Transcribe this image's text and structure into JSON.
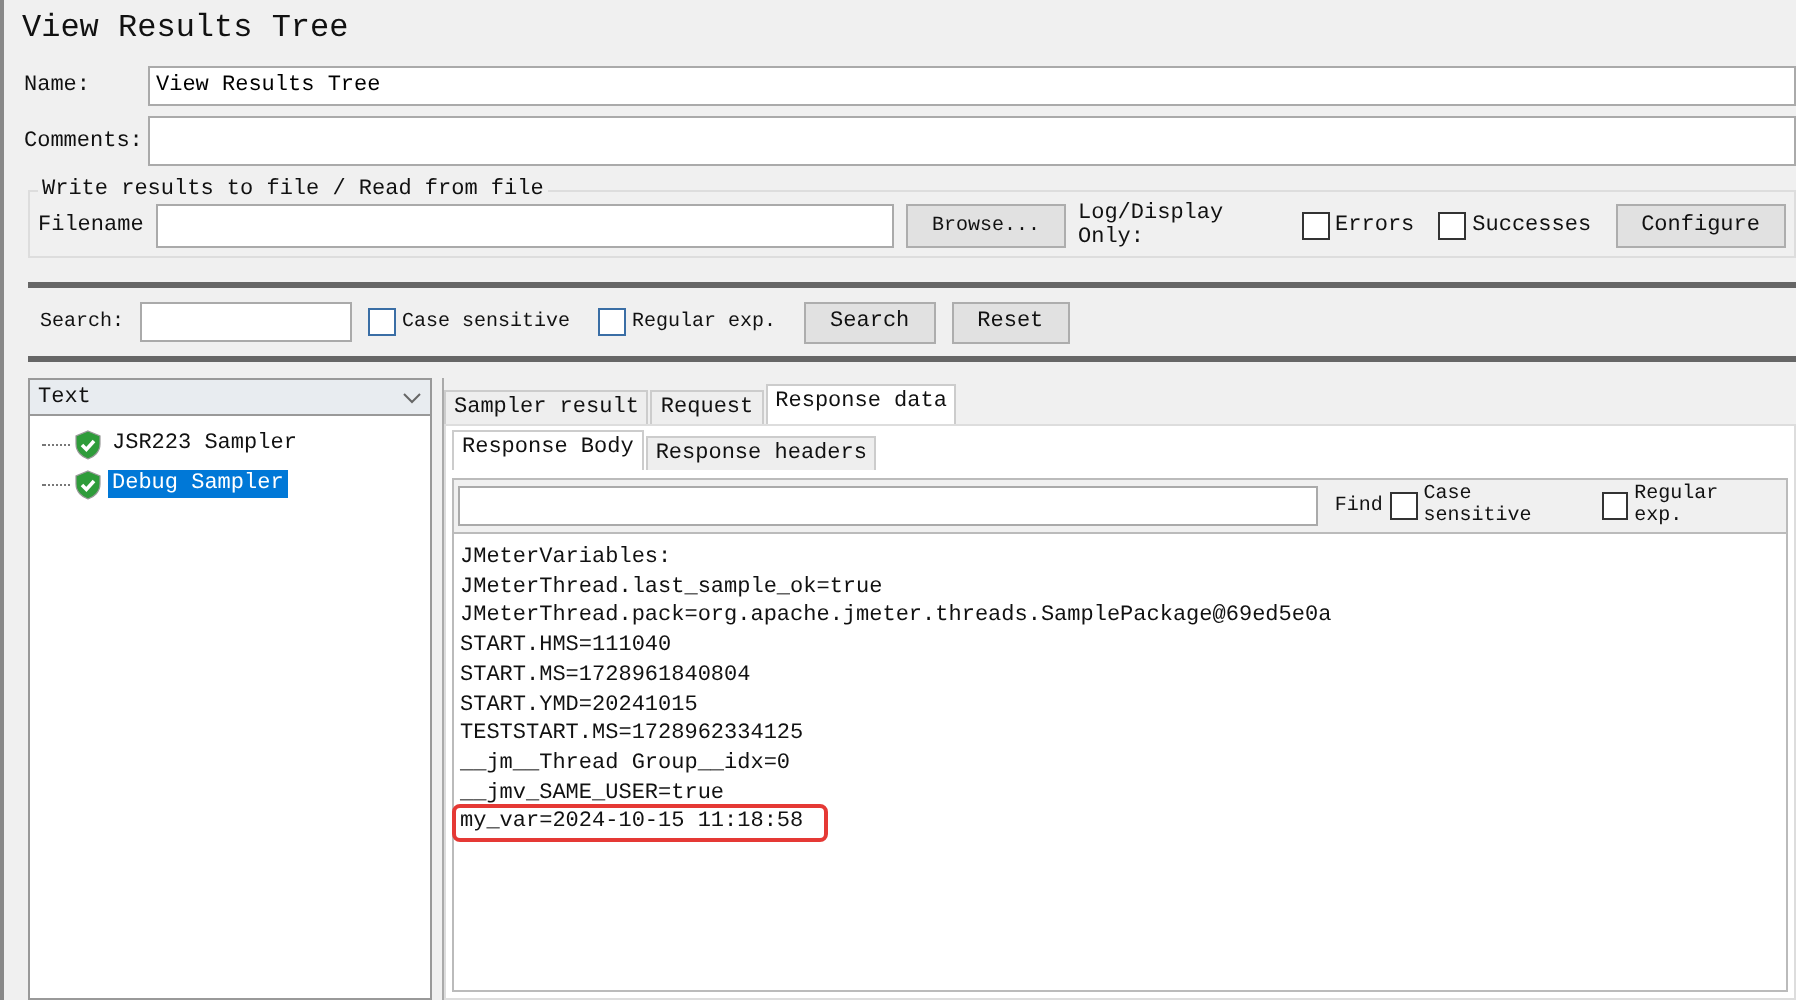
{
  "title": "View Results Tree",
  "name_field": {
    "label": "Name:",
    "value": "View Results Tree"
  },
  "comments_field": {
    "label": "Comments:"
  },
  "file_group": {
    "legend": "Write results to file / Read from file",
    "label": "Filename",
    "browse": "Browse...",
    "log_label": "Log/Display Only:",
    "options": [
      {
        "label": "Errors",
        "checked": false
      },
      {
        "label": "Successes",
        "checked": false
      }
    ],
    "configure": "Configure"
  },
  "search": {
    "label": "Search:",
    "options": [
      {
        "label": "Case sensitive",
        "checked": false
      },
      {
        "label": "Regular exp.",
        "checked": false
      }
    ],
    "buttons": [
      "Search",
      "Reset"
    ]
  },
  "renderer": "Text",
  "tree": [
    {
      "label": "JSR223 Sampler",
      "selected": false
    },
    {
      "label": "Debug Sampler",
      "selected": true
    }
  ],
  "tabs": [
    {
      "label": "Sampler result",
      "selected": false
    },
    {
      "label": "Request",
      "selected": false
    },
    {
      "label": "Response data",
      "selected": true
    }
  ],
  "subtabs": [
    {
      "label": "Response Body",
      "selected": true
    },
    {
      "label": "Response headers",
      "selected": false
    }
  ],
  "find": {
    "label": "Find",
    "options": [
      {
        "label": "Case sensitive",
        "checked": false
      },
      {
        "label": "Regular exp.",
        "checked": false
      }
    ]
  },
  "lines": [
    {
      "text": "JMeterVariables:",
      "highlighted": false
    },
    {
      "text": "JMeterThread.last_sample_ok=true",
      "highlighted": false
    },
    {
      "text": "JMeterThread.pack=org.apache.jmeter.threads.SamplePackage@69ed5e0a",
      "highlighted": false
    },
    {
      "text": "START.HMS=111040",
      "highlighted": false
    },
    {
      "text": "START.MS=1728961840804",
      "highlighted": false
    },
    {
      "text": "START.YMD=20241015",
      "highlighted": false
    },
    {
      "text": "TESTSTART.MS=1728962334125",
      "highlighted": false
    },
    {
      "text": "__jm__Thread Group__idx=0",
      "highlighted": false
    },
    {
      "text": "__jmv_SAME_USER=true",
      "highlighted": false
    },
    {
      "text": "my_var=2024-10-15 11:18:58",
      "highlighted": true
    }
  ]
}
